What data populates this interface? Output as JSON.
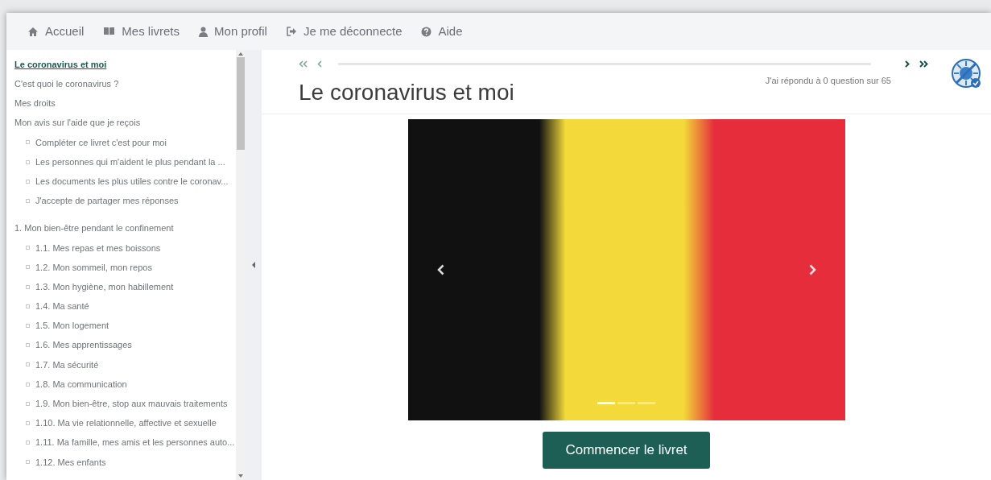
{
  "nav": [
    {
      "label": "Accueil"
    },
    {
      "label": "Mes livrets"
    },
    {
      "label": "Mon profil"
    },
    {
      "label": "Je me déconnecte"
    },
    {
      "label": "Aide"
    }
  ],
  "sidebar": {
    "items": [
      {
        "label": "Le coronavirus et moi",
        "selected": true
      },
      {
        "label": "C'est quoi le coronavirus ?",
        "selected": false
      },
      {
        "label": "Mes droits",
        "selected": false
      },
      {
        "label": "Mon avis sur l'aide que je reçois",
        "selected": false,
        "children": [
          {
            "label": "Compléter ce livret c'est pour moi",
            "selected": false
          },
          {
            "label": "Les personnes qui m'aident le plus pendant la ...",
            "selected": false
          },
          {
            "label": "Les documents les plus utiles contre le coronav...",
            "selected": false
          },
          {
            "label": "J'accepte de partager mes réponses",
            "selected": false
          }
        ]
      },
      {
        "label": "1. Mon bien-être pendant le confinement",
        "selected": false,
        "children": [
          {
            "label": "1.1. Mes repas et mes boissons",
            "selected": false
          },
          {
            "label": "1.2. Mon sommeil, mon repos",
            "selected": false
          },
          {
            "label": "1.3. Mon hygiène, mon habillement",
            "selected": false
          },
          {
            "label": "1.4. Ma santé",
            "selected": false
          },
          {
            "label": "1.5. Mon logement",
            "selected": false
          },
          {
            "label": "1.6. Mes apprentissages",
            "selected": false
          },
          {
            "label": "1.7. Ma sécurité",
            "selected": false
          },
          {
            "label": "1.8. Ma communication",
            "selected": false
          },
          {
            "label": "1.9. Mon bien-être, stop aux mauvais traitements",
            "selected": false
          },
          {
            "label": "1.10. Ma vie relationnelle, affective et sexuelle",
            "selected": false
          },
          {
            "label": "1.11. Ma famille, mes amis et les personnes auto...",
            "selected": false
          },
          {
            "label": "1.12. Mes enfants",
            "selected": false
          }
        ]
      }
    ]
  },
  "main": {
    "title": "Le coronavirus et moi",
    "progress_text": "J'ai répondu à 0 question sur 65",
    "carousel": {
      "slides": [
        {
          "selected": true
        },
        {
          "selected": false
        },
        {
          "selected": false
        }
      ]
    },
    "start_button": "Commencer le livret"
  }
}
